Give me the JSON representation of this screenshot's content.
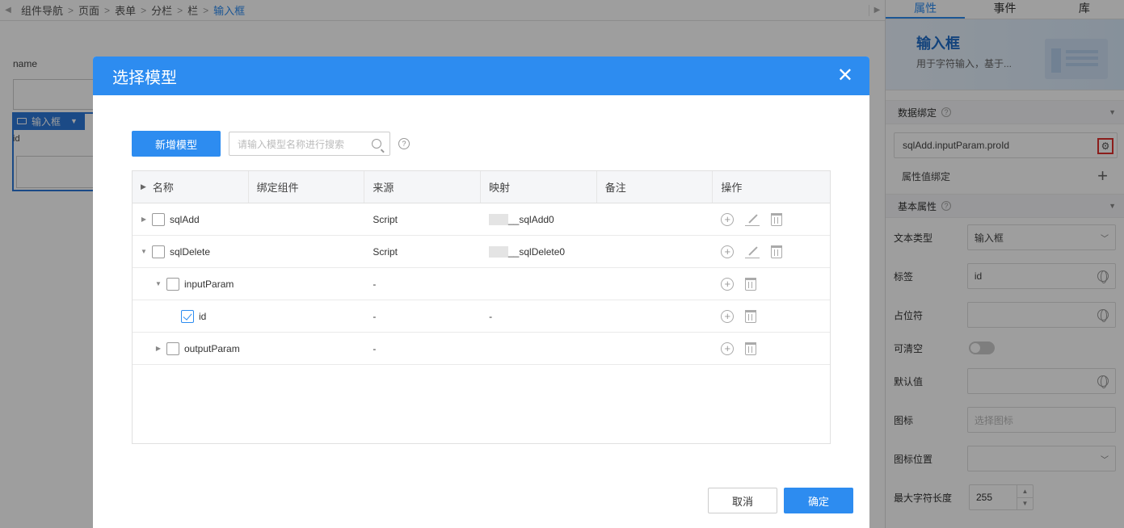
{
  "breadcrumb": [
    "组件导航",
    "页面",
    "表单",
    "分栏",
    "栏",
    "输入框"
  ],
  "canvas": {
    "field_label": "name",
    "selected_tag": "输入框",
    "field_label_2": "id"
  },
  "panel": {
    "tabs": [
      "属性",
      "事件",
      "库"
    ],
    "component_title": "输入框",
    "component_desc": "用于字符输入，基于...",
    "data_binding_title": "数据绑定",
    "binding_value": "sqlAdd.inputParam.proId",
    "attr_value_binding": "属性值绑定",
    "basic_props_title": "基本属性",
    "props": {
      "text_type_label": "文本类型",
      "text_type_value": "输入框",
      "tag_label": "标签",
      "tag_value": "id",
      "placeholder_label": "占位符",
      "clearable_label": "可清空",
      "default_label": "默认值",
      "icon_label": "图标",
      "icon_placeholder": "选择图标",
      "icon_position_label": "图标位置",
      "max_length_label": "最大字符长度",
      "max_length_value": "255"
    }
  },
  "modal": {
    "title": "选择模型",
    "add_button": "新增模型",
    "search_placeholder": "请输入模型名称进行搜索",
    "columns": [
      "名称",
      "绑定组件",
      "来源",
      "映射",
      "备注",
      "操作"
    ],
    "rows": [
      {
        "name": "sqlAdd",
        "source": "Script",
        "mapping": "__sqlAdd0"
      },
      {
        "name": "sqlDelete",
        "source": "Script",
        "mapping": "__sqlDelete0"
      },
      {
        "name": "inputParam",
        "source": "-",
        "mapping": ""
      },
      {
        "name": "id",
        "source": "-",
        "mapping": "-"
      },
      {
        "name": "outputParam",
        "source": "-",
        "mapping": ""
      }
    ],
    "cancel": "取消",
    "confirm": "确定"
  }
}
